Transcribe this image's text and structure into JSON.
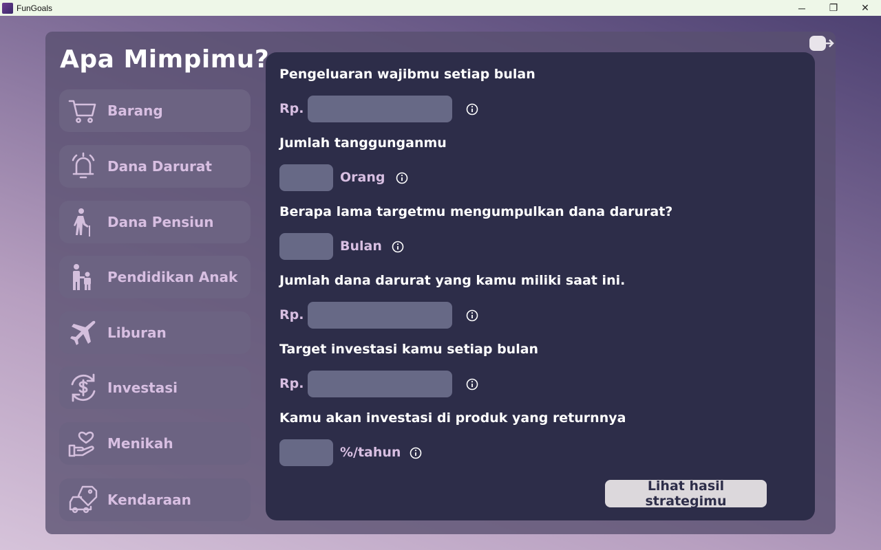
{
  "window": {
    "title": "FunGoals",
    "minimize_glyph": "─",
    "restore_glyph": "❐",
    "close_glyph": "✕"
  },
  "sidebar": {
    "heading": "Apa Mimpimu?",
    "items": [
      {
        "label": "Barang",
        "icon": "shopping-cart-icon"
      },
      {
        "label": "Dana Darurat",
        "icon": "alarm-bell-icon"
      },
      {
        "label": "Dana Pensiun",
        "icon": "elderly-person-icon"
      },
      {
        "label": "Pendidikan Anak",
        "icon": "parent-child-icon"
      },
      {
        "label": "Liburan",
        "icon": "airplane-icon"
      },
      {
        "label": "Investasi",
        "icon": "money-cycle-icon"
      },
      {
        "label": "Menikah",
        "icon": "heart-hand-icon"
      },
      {
        "label": "Kendaraan",
        "icon": "car-tag-icon"
      }
    ]
  },
  "form": {
    "fields": [
      {
        "label": "Pengeluaran wajibmu setiap bulan",
        "prefix": "Rp.",
        "value": ""
      },
      {
        "label": "Jumlah tanggunganmu",
        "suffix": "Orang",
        "value": ""
      },
      {
        "label": "Berapa lama targetmu mengumpulkan dana darurat?",
        "suffix": "Bulan",
        "value": ""
      },
      {
        "label": "Jumlah dana darurat yang kamu miliki saat ini.",
        "prefix": "Rp.",
        "value": ""
      },
      {
        "label": "Target investasi kamu setiap bulan",
        "prefix": "Rp.",
        "value": ""
      },
      {
        "label": "Kamu akan investasi di produk yang returnnya",
        "suffix": "%/tahun",
        "value": ""
      }
    ],
    "submit_label": "Lihat hasil strategimu"
  },
  "colors": {
    "panel": "#585070",
    "card": "#2d2d49",
    "nav_button": "#6c6382",
    "accent_text": "#d8bfe2",
    "input": "#676986",
    "button": "#dcd8dc"
  }
}
